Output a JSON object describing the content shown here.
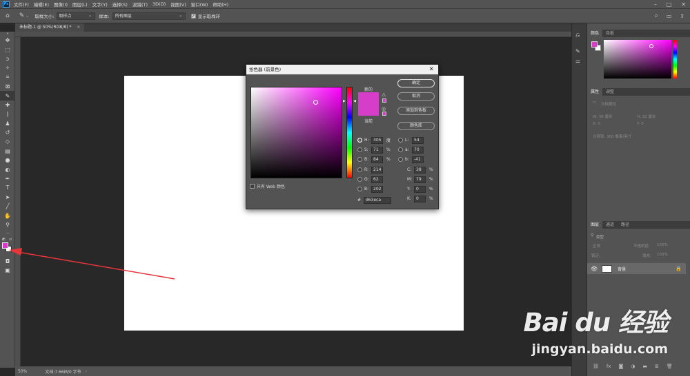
{
  "menu": {
    "logo": "Ps",
    "items": [
      "文件(F)",
      "编辑(E)",
      "图像(I)",
      "图层(L)",
      "文字(Y)",
      "选择(S)",
      "滤镜(T)",
      "3D(D)",
      "视图(V)",
      "窗口(W)",
      "帮助(H)"
    ]
  },
  "options": {
    "sample_size_label": "取样大小:",
    "sample_size_value": "取样点",
    "sample_label": "样本:",
    "sample_value": "所有图层",
    "show_ring_label": "显示取样环"
  },
  "document": {
    "tab_title": "未标题-1 @ 50%(RGB/8) *",
    "zoom": "50%",
    "doc_info": "文档:7.66M/0 字节"
  },
  "picker": {
    "title": "拾色器 (前景色)",
    "new_label": "新的",
    "current_label": "当前",
    "buttons": {
      "ok": "确定",
      "cancel": "取消",
      "add_swatch": "添加到色板",
      "libraries": "颜色库"
    },
    "web_only_label": "只有 Web 颜色",
    "hsb": [
      {
        "label": "H:",
        "value": "305",
        "unit": "度"
      },
      {
        "label": "S:",
        "value": "71",
        "unit": "%"
      },
      {
        "label": "B:",
        "value": "84",
        "unit": "%"
      }
    ],
    "rgb": [
      {
        "label": "R:",
        "value": "214"
      },
      {
        "label": "G:",
        "value": "62"
      },
      {
        "label": "B:",
        "value": "202"
      }
    ],
    "lab": [
      {
        "label": "L:",
        "value": "54"
      },
      {
        "label": "a:",
        "value": "70"
      },
      {
        "label": "b:",
        "value": "-41"
      }
    ],
    "cmyk": [
      {
        "label": "C:",
        "value": "38",
        "unit": "%"
      },
      {
        "label": "M:",
        "value": "79",
        "unit": "%"
      },
      {
        "label": "Y:",
        "value": "0",
        "unit": "%"
      },
      {
        "label": "K:",
        "value": "0",
        "unit": "%"
      }
    ],
    "hex_label": "#",
    "hex": "d63eca",
    "color": "#d63eca"
  },
  "panels": {
    "color_tabs": [
      "颜色",
      "色板"
    ],
    "props_tabs": [
      "属性",
      "调整"
    ],
    "doc_props": "文档属性",
    "props_w": "W: 36 厘米",
    "props_h": "H: 32 厘米",
    "props_x": "X: 0",
    "props_y": "Y: 0",
    "resolution": "分辨率: 300 像素/英寸",
    "layers_tabs": [
      "图层",
      "通道",
      "路径"
    ],
    "layer_kind": "类型",
    "blend_mode": "正常",
    "opacity_label": "不透明度:",
    "opacity": "100%",
    "lock_label": "锁定:",
    "fill_label": "填充:",
    "fill": "100%",
    "layer_name": "背景"
  },
  "watermark": {
    "brand": "Bai du 经验",
    "url": "jingyan.baidu.com"
  }
}
